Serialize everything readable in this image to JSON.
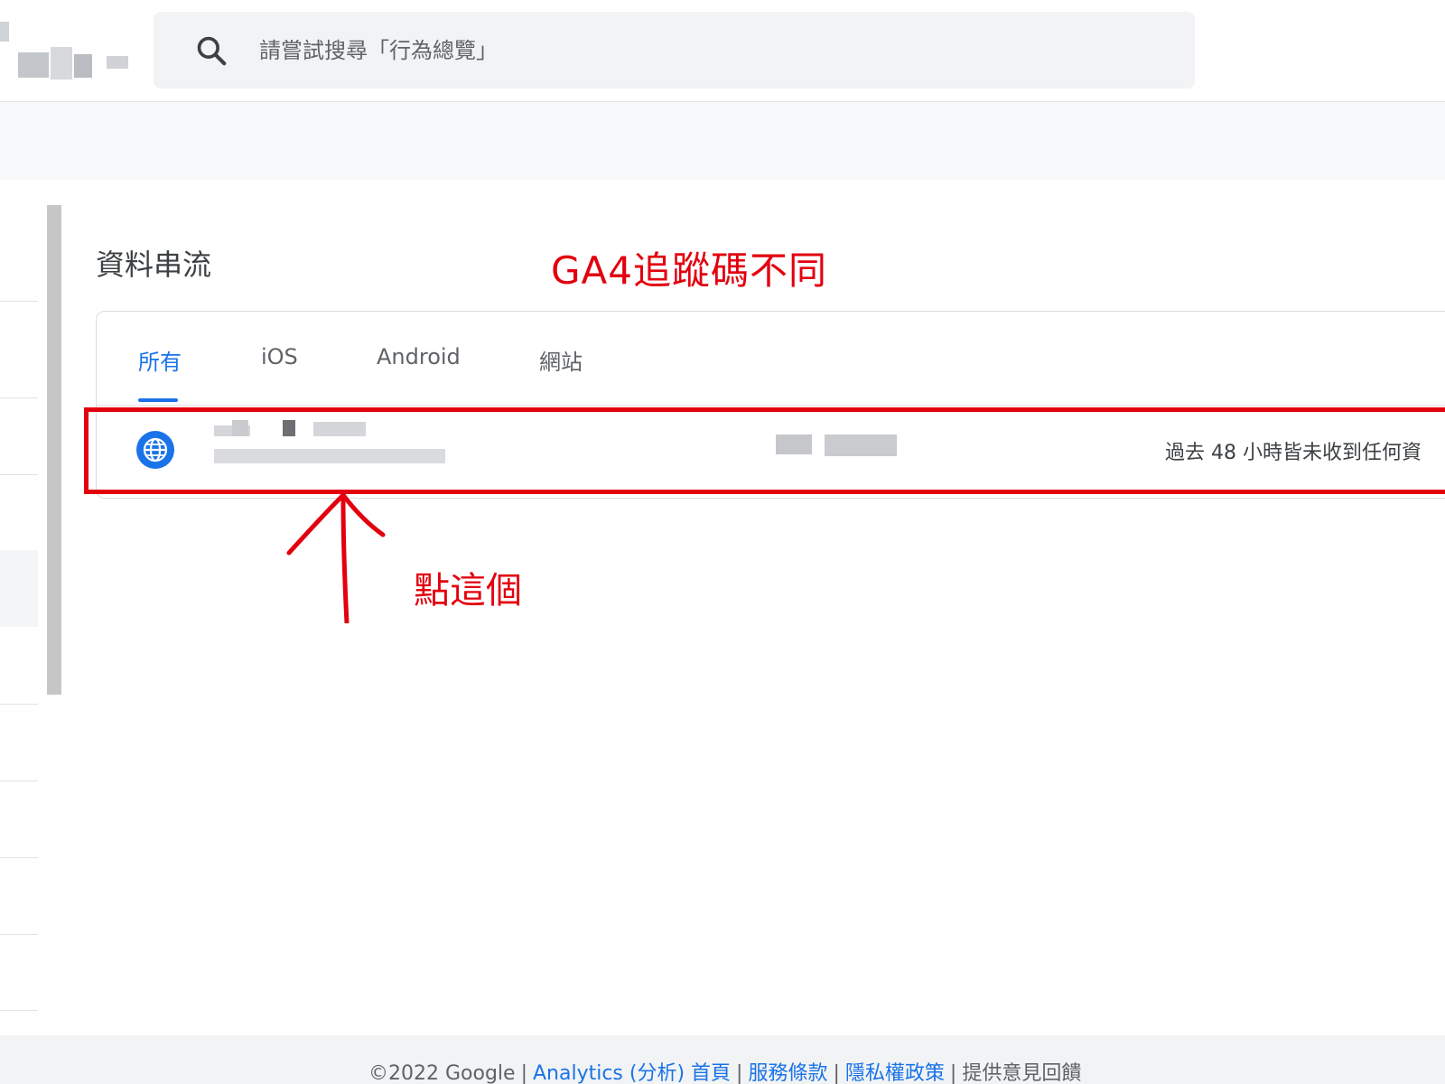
{
  "search": {
    "placeholder": "請嘗試搜尋「行為總覽」"
  },
  "main": {
    "title": "資料串流",
    "annotation_top": "GA4追蹤碼不同",
    "annotation_click": "點這個"
  },
  "tabs": [
    {
      "label": "所有"
    },
    {
      "label": "iOS"
    },
    {
      "label": "Android"
    },
    {
      "label": "網站"
    }
  ],
  "stream": {
    "status": "過去 48 小時皆未收到任何資"
  },
  "footer": {
    "copyright": "©2022 Google",
    "links": [
      "Analytics (分析) 首頁",
      "服務條款",
      "隱私權政策"
    ],
    "feedback": "提供意見回饋"
  },
  "colors": {
    "accent": "#1a73e8",
    "annotation": "#e3000e"
  }
}
